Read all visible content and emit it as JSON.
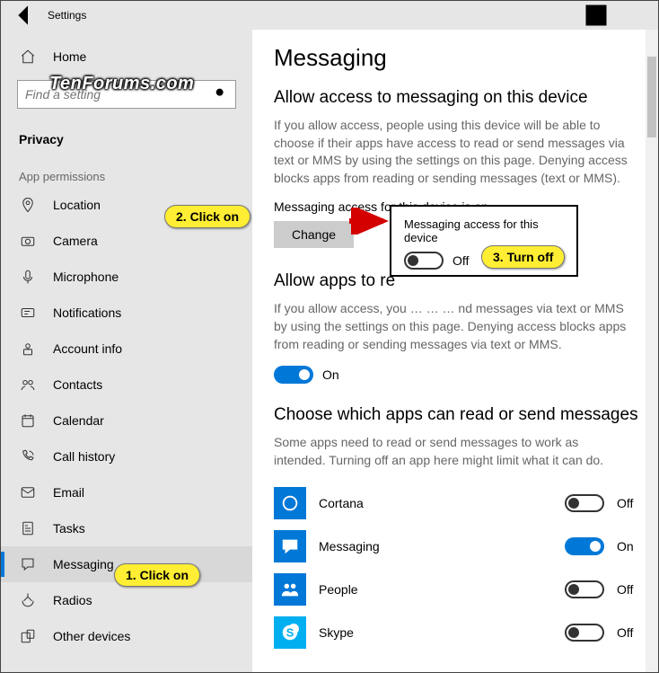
{
  "window": {
    "title": "Settings"
  },
  "sidebar": {
    "home": "Home",
    "search_placeholder": "Find a setting",
    "section": "Privacy",
    "subsection": "App permissions",
    "items": [
      "Location",
      "Camera",
      "Microphone",
      "Notifications",
      "Account info",
      "Contacts",
      "Calendar",
      "Call history",
      "Email",
      "Tasks",
      "Messaging",
      "Radios",
      "Other devices"
    ],
    "selected_index": 10
  },
  "page": {
    "title": "Messaging",
    "section1": {
      "heading": "Allow access to messaging on this device",
      "desc": "If you allow access, people using this device will be able to choose if their apps have access to read or send messages via text or MMS by using the settings on this page. Denying access blocks apps from reading or sending messages (text or MMS).",
      "status": "Messaging access for this device is on",
      "change_label": "Change"
    },
    "section2": {
      "heading": "Allow apps to re",
      "desc": "If you allow access, you … … … nd messages via text or MMS by using the settings on this page. Denying access blocks apps from reading or sending messages via text or MMS.",
      "toggle_state": "On"
    },
    "section3": {
      "heading": "Choose which apps can read or send messages",
      "desc": "Some apps need to read or send messages to work as intended. Turning off an app here might limit what it can do."
    },
    "apps": [
      {
        "name": "Cortana",
        "on": false,
        "state": "Off",
        "color": "#0078d7"
      },
      {
        "name": "Messaging",
        "on": true,
        "state": "On",
        "color": "#0078d7"
      },
      {
        "name": "People",
        "on": false,
        "state": "Off",
        "color": "#0078d7"
      },
      {
        "name": "Skype",
        "on": false,
        "state": "Off",
        "color": "#00aff0"
      }
    ]
  },
  "popup": {
    "title": "Messaging access for this device",
    "state": "Off"
  },
  "callouts": {
    "c1": "1. Click on",
    "c2": "2. Click on",
    "c3": "3. Turn off"
  },
  "watermark": "TenForums.com"
}
